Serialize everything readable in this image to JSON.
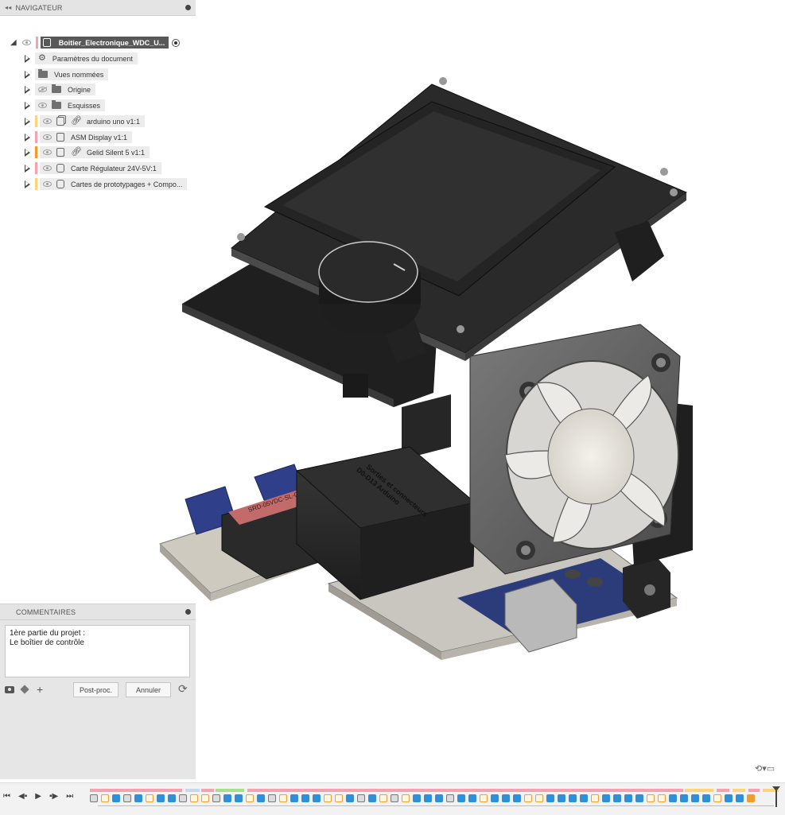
{
  "navigator": {
    "title": "NAVIGATEUR",
    "root": {
      "label": "Boitier_Electronique_WDC_U..."
    },
    "items": [
      {
        "label": "Paramètres du document",
        "icon": "gear-icon",
        "bar": ""
      },
      {
        "label": "Vues nommées",
        "icon": "folder-icon",
        "bar": ""
      },
      {
        "label": "Origine",
        "icon": "folder-icon",
        "bar": "",
        "hidden": true
      },
      {
        "label": "Esquisses",
        "icon": "folder-icon",
        "bar": ""
      },
      {
        "label": "arduino uno v1:1",
        "icon": "component-icon",
        "bar": "#ffd37a",
        "link": true
      },
      {
        "label": "ASM Display v1:1",
        "icon": "component-icon",
        "bar": "#f4a2b0"
      },
      {
        "label": "Gelid Silent 5 v1:1",
        "icon": "component-icon",
        "bar": "#f39a2c",
        "link": true
      },
      {
        "label": "Carte Régulateur 24V-5V:1",
        "icon": "body-icon",
        "bar": "#f4a2b0"
      },
      {
        "label": "Cartes de prototypages + Compo...",
        "icon": "body-icon",
        "bar": "#ffd37a"
      }
    ]
  },
  "comments": {
    "title": "COMMENTAIRES",
    "text": "1ère partie du projet :\nLe boîtier de contrôle",
    "post_label": "Post-proc.",
    "cancel_label": "Annuler"
  },
  "model": {
    "fan_text": "",
    "box_text": "Sorties et connecteurs\nD0-D13 Arduino",
    "relay_text": "SRD-05VDC-SL-C"
  },
  "colors": {
    "root_bar": "#f4a2b0",
    "chip": "#585858",
    "feature_blue": "#2f8fd8"
  }
}
